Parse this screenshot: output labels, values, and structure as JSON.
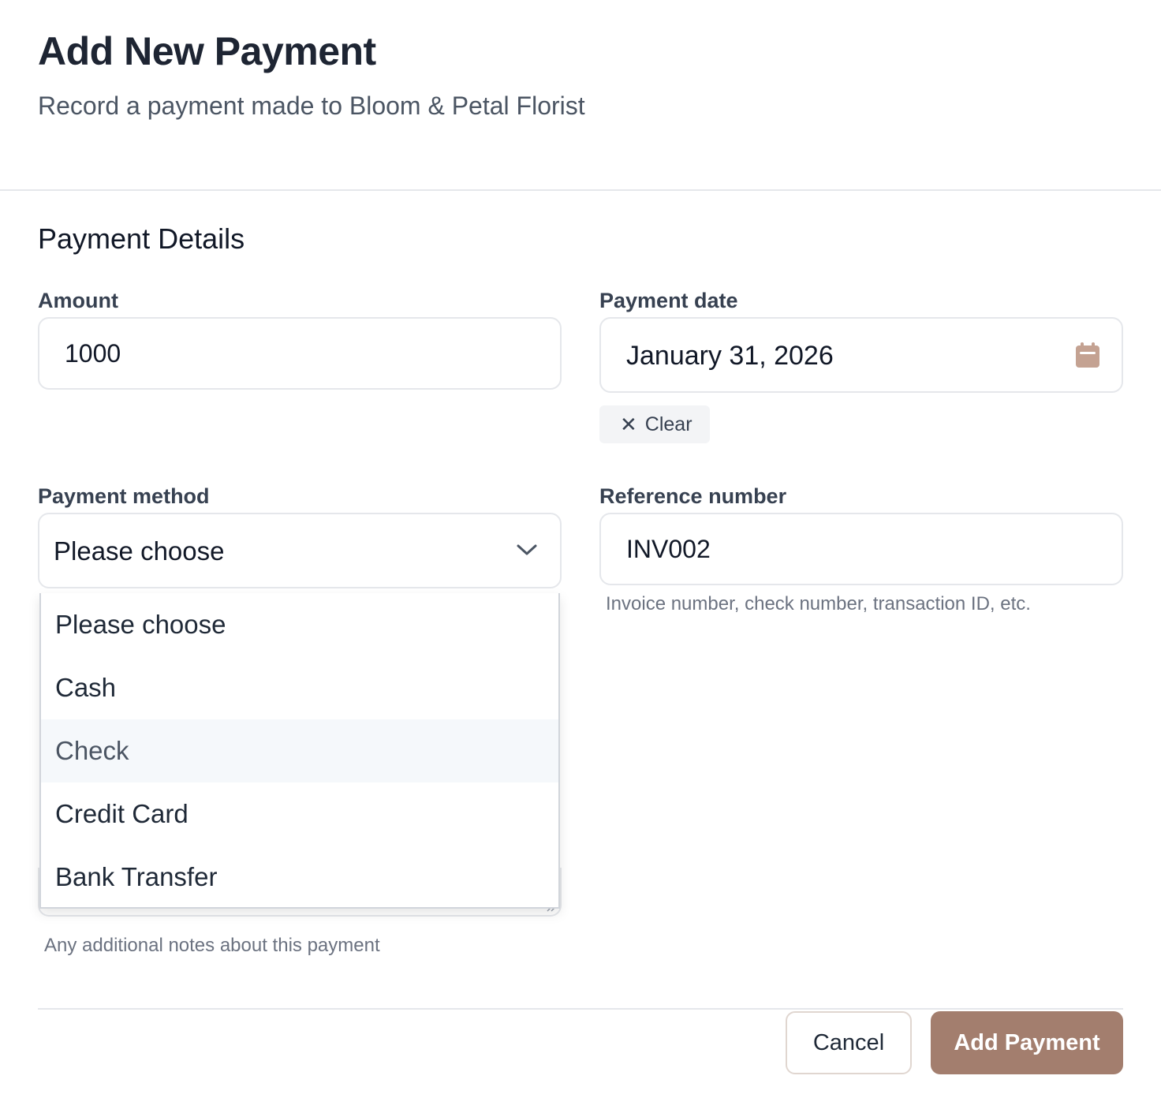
{
  "dialog": {
    "title": "Add New Payment",
    "subtitle": "Record a payment made to Bloom & Petal Florist"
  },
  "section": {
    "title": "Payment Details"
  },
  "fields": {
    "amount": {
      "label": "Amount",
      "value": "1000"
    },
    "payment_date": {
      "label": "Payment date",
      "value": "January 31, 2026",
      "clear_label": "Clear"
    },
    "payment_method": {
      "label": "Payment method",
      "selected": "Please choose",
      "options": [
        "Please choose",
        "Cash",
        "Check",
        "Credit Card",
        "Bank Transfer"
      ],
      "hovered_option": "Check"
    },
    "reference_number": {
      "label": "Reference number",
      "value": "INV002",
      "helper": "Invoice number, check number, transaction ID, etc."
    },
    "notes": {
      "helper": "Any additional notes about this payment"
    }
  },
  "footer": {
    "cancel_label": "Cancel",
    "submit_label": "Add Payment"
  },
  "colors": {
    "accent": "#a37e6e",
    "calendar_icon": "#c4a292",
    "hover_bg": "#f5f8fb"
  },
  "icons": {
    "calendar": "calendar-icon",
    "chevron": "chevron-down-icon",
    "clear": "close-icon",
    "resize": "resize-handle-icon"
  }
}
